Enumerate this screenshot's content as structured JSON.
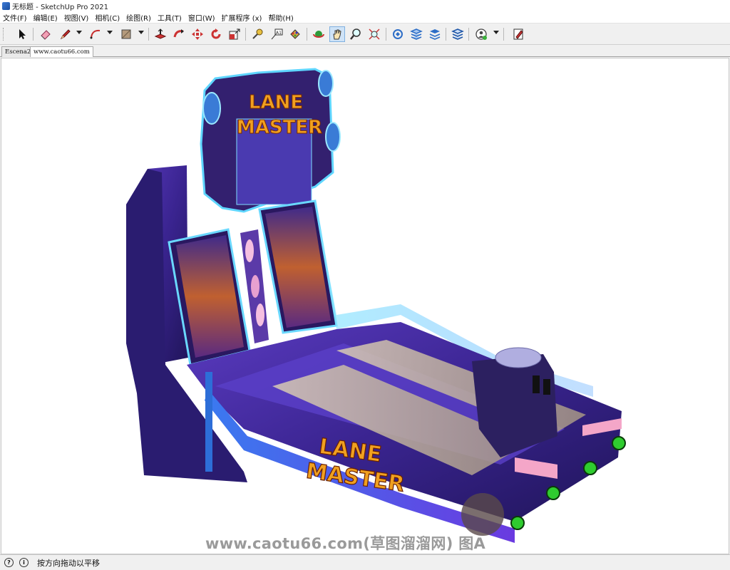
{
  "window": {
    "title": "无标题 - SketchUp Pro 2021"
  },
  "menu": [
    "文件(F)",
    "编辑(E)",
    "视图(V)",
    "相机(C)",
    "绘图(R)",
    "工具(T)",
    "窗口(W)",
    "扩展程序 (x)",
    "帮助(H)"
  ],
  "scene_tabs": [
    "Escena2",
    "www.caotu66.com"
  ],
  "model": {
    "marquee_text": [
      "LANE",
      "MASTER"
    ],
    "side_text": [
      "LANE",
      "MASTER"
    ]
  },
  "watermark": "www.caotu66.com(草图溜溜网) 图A",
  "status": {
    "text": "按方向拖动以平移",
    "icon1": "?",
    "icon2": "i"
  },
  "colors": {
    "cabinet_purple": "#4a2f9e",
    "lane_blue": "#2b5fd0",
    "glow": "#6af0ff",
    "logo_orange": "#f0a020",
    "toolbar_active": "#cfe3f7"
  }
}
